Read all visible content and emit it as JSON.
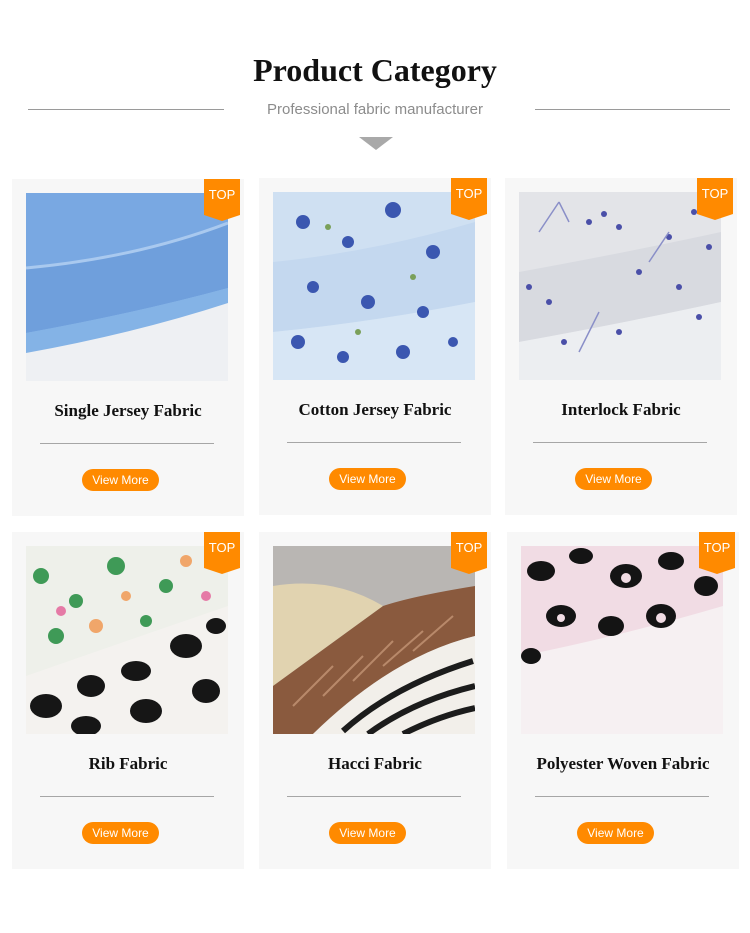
{
  "header": {
    "title": "Product Category",
    "subtitle": "Professional fabric manufacturer"
  },
  "colors": {
    "accent": "#ff8a00",
    "card_bg": "#f7f7f7"
  },
  "cards": [
    {
      "title": "Single Jersey Fabric",
      "badge": "TOP",
      "button": "View More",
      "image": "light-blue-jersey-fabric"
    },
    {
      "title": "Cotton Jersey Fabric",
      "badge": "TOP",
      "button": "View More",
      "image": "blue-floral-jersey-fabric"
    },
    {
      "title": "Interlock Fabric",
      "badge": "TOP",
      "button": "View More",
      "image": "grey-floral-interlock-fabric"
    },
    {
      "title": "Rib Fabric",
      "badge": "TOP",
      "button": "View More",
      "image": "floral-and-leopard-rib-fabric"
    },
    {
      "title": "Hacci Fabric",
      "badge": "TOP",
      "button": "View More",
      "image": "metallic-and-zebra-hacci-fabric"
    },
    {
      "title": "Polyester Woven Fabric",
      "badge": "TOP",
      "button": "View More",
      "image": "pink-cow-print-woven-fabric"
    }
  ]
}
